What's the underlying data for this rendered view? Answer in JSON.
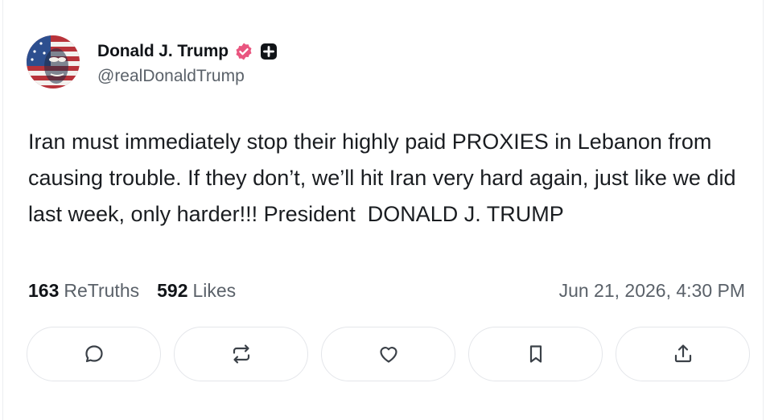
{
  "author": {
    "display_name": "Donald J. Trump",
    "handle": "@realDonaldTrump",
    "verified_badge_color": "#e9557f"
  },
  "post": {
    "text": "Iran must immediately stop their highly paid PROXIES in Lebanon from causing trouble. If they don’t, we’ll hit Iran very hard again, just like we did last week, only harder!!! President  DONALD J. TRUMP"
  },
  "stats": {
    "retruths_count": "163",
    "retruths_label": "ReTruths",
    "likes_count": "592",
    "likes_label": "Likes",
    "timestamp": "Jun 21, 2026, 4:30 PM"
  },
  "actions": [
    {
      "icon": "reply-icon"
    },
    {
      "icon": "retruth-icon"
    },
    {
      "icon": "heart-icon"
    },
    {
      "icon": "bookmark-icon"
    },
    {
      "icon": "share-icon"
    }
  ],
  "colors": {
    "text": "#111418",
    "muted": "#5a6169",
    "border": "#e4e6ea"
  }
}
